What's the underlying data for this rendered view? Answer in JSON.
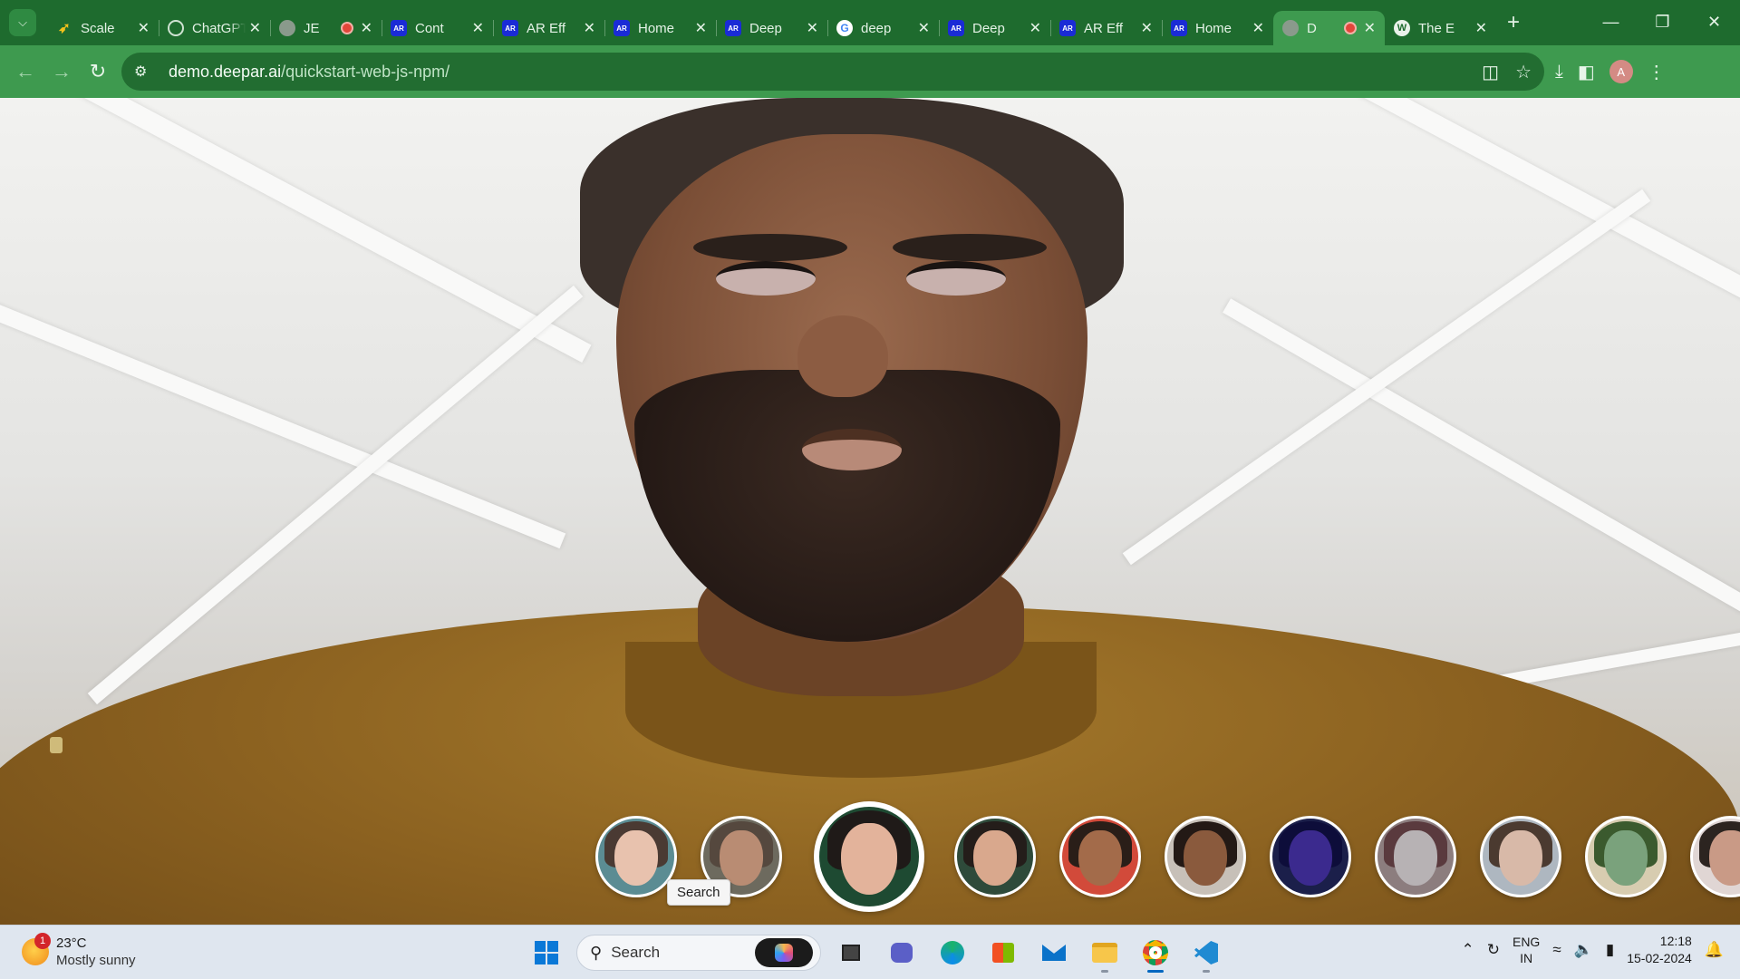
{
  "browser": {
    "tabs": [
      {
        "title": "Scale",
        "favicon": "scale-icon",
        "active": false,
        "recording": false
      },
      {
        "title": "ChatGPT",
        "favicon": "chatgpt-icon",
        "active": false,
        "recording": false
      },
      {
        "title": "JE",
        "favicon": "globe-icon",
        "active": false,
        "recording": true
      },
      {
        "title": "Cont",
        "favicon": "ar-icon",
        "active": false,
        "recording": false
      },
      {
        "title": "AR Eff",
        "favicon": "ar-icon",
        "active": false,
        "recording": false
      },
      {
        "title": "Home",
        "favicon": "ar-icon",
        "active": false,
        "recording": false
      },
      {
        "title": "Deep",
        "favicon": "ar-icon",
        "active": false,
        "recording": false
      },
      {
        "title": "deep",
        "favicon": "google-icon",
        "active": false,
        "recording": false
      },
      {
        "title": "Deep",
        "favicon": "ar-icon",
        "active": false,
        "recording": false
      },
      {
        "title": "AR Eff",
        "favicon": "ar-icon",
        "active": false,
        "recording": false
      },
      {
        "title": "Home",
        "favicon": "ar-icon",
        "active": false,
        "recording": false
      },
      {
        "title": "D",
        "favicon": "globe-icon",
        "active": true,
        "recording": true
      },
      {
        "title": "The E",
        "favicon": "wordpress-icon",
        "active": false,
        "recording": false
      }
    ],
    "favicon_text": {
      "ar": "AR",
      "google": "G",
      "wordpress": "W",
      "scale": "➶"
    },
    "address": {
      "host": "demo.deepar.ai",
      "path": "/quickstart-web-js-npm/"
    },
    "profile_initial": "A",
    "colors": {
      "frame": "#1e6b2e",
      "toolbar": "#3e9a4f",
      "omnibox": "#226d31"
    }
  },
  "page": {
    "filters": [
      {
        "name": "filter-glasses-woman",
        "skin": "#e8c2ae",
        "hair": "#4a3a33",
        "bg": "#5b8c93",
        "selected": false
      },
      {
        "name": "filter-viking",
        "skin": "#b98c73",
        "hair": "#55483e",
        "bg": "#6d6a5e",
        "selected": false
      },
      {
        "name": "filter-flower-woman",
        "skin": "#e3b39b",
        "hair": "#1f1a18",
        "bg": "#1e4a32",
        "selected": true
      },
      {
        "name": "filter-woman-dark-hair",
        "skin": "#d9a88d",
        "hair": "#241d1a",
        "bg": "#2e4a3a",
        "selected": false
      },
      {
        "name": "filter-makeup-man",
        "skin": "#a36b4a",
        "hair": "#2a1e18",
        "bg": "#d24a3a",
        "selected": false
      },
      {
        "name": "filter-smiling-man",
        "skin": "#8a5a3d",
        "hair": "#231915",
        "bg": "#c7c0b8",
        "selected": false
      },
      {
        "name": "filter-galaxy",
        "skin": "#3b2a8e",
        "hair": "#0d0d3a",
        "bg": "#1b1f4a",
        "selected": false
      },
      {
        "name": "filter-skull-mask",
        "skin": "#b7b2b4",
        "hair": "#5a3a3e",
        "bg": "#8c7d7e",
        "selected": false
      },
      {
        "name": "filter-devil-horns",
        "skin": "#d8b9a8",
        "hair": "#4b3a30",
        "bg": "#aeb7c0",
        "selected": false
      },
      {
        "name": "filter-alien",
        "skin": "#7aa27c",
        "hair": "#3b5a2e",
        "bg": "#d7ccb0",
        "selected": false
      },
      {
        "name": "filter-red-mask",
        "skin": "#c99a86",
        "hair": "#2c2420",
        "bg": "#e0d6d4",
        "selected": false
      }
    ],
    "tooltip": "Search"
  },
  "taskbar": {
    "weather": {
      "temp": "23°C",
      "condition": "Mostly sunny",
      "badge": "1"
    },
    "search_placeholder": "Search",
    "language": {
      "line1": "ENG",
      "line2": "IN"
    },
    "clock": {
      "time": "12:18",
      "date": "15-02-2024"
    }
  }
}
